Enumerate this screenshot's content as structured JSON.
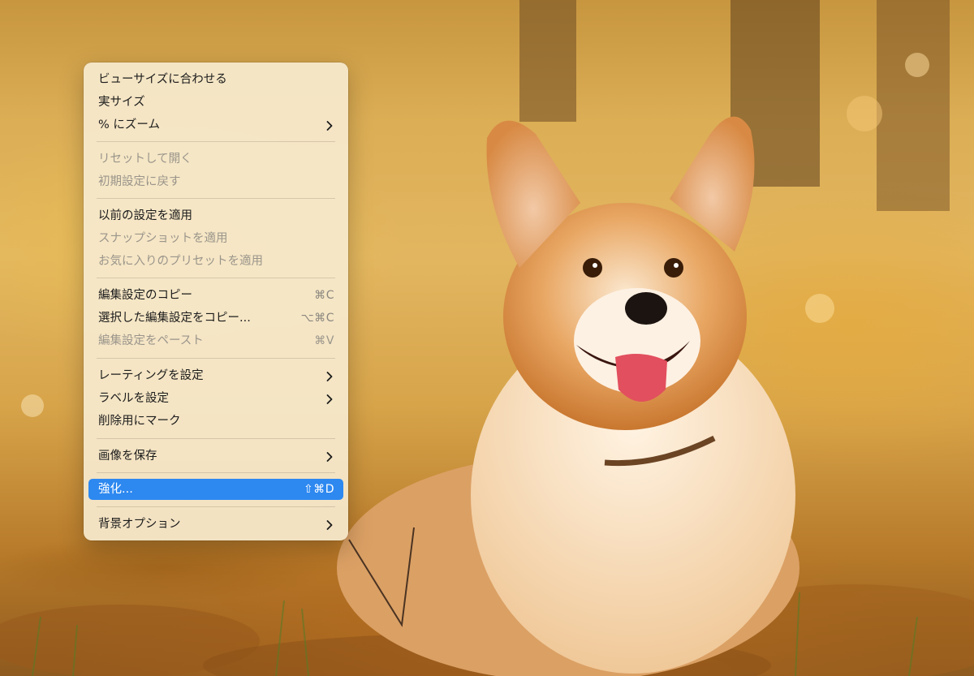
{
  "menu": {
    "items": [
      {
        "label": "ビューサイズに合わせる"
      },
      {
        "label": "実サイズ"
      },
      {
        "label": "% にズーム"
      },
      {
        "label": "リセットして開く"
      },
      {
        "label": "初期設定に戻す"
      },
      {
        "label": "以前の設定を適用"
      },
      {
        "label": "スナップショットを適用"
      },
      {
        "label": "お気に入りのプリセットを適用"
      },
      {
        "label": "編集設定のコピー",
        "shortcut": "⌘C"
      },
      {
        "label": "選択した編集設定をコピー...",
        "shortcut": "⌥⌘C"
      },
      {
        "label": "編集設定をペースト",
        "shortcut": "⌘V"
      },
      {
        "label": "レーティングを設定"
      },
      {
        "label": "ラベルを設定"
      },
      {
        "label": "削除用にマーク"
      },
      {
        "label": "画像を保存"
      },
      {
        "label": "強化...",
        "shortcut": "⇧⌘D"
      },
      {
        "label": "背景オプション"
      }
    ]
  },
  "colors": {
    "highlight": "#2d88f0",
    "menu_bg": "#f6eacd",
    "disabled_text": "#9a958b"
  },
  "icons": {
    "submenu": "chevron-right-icon"
  }
}
